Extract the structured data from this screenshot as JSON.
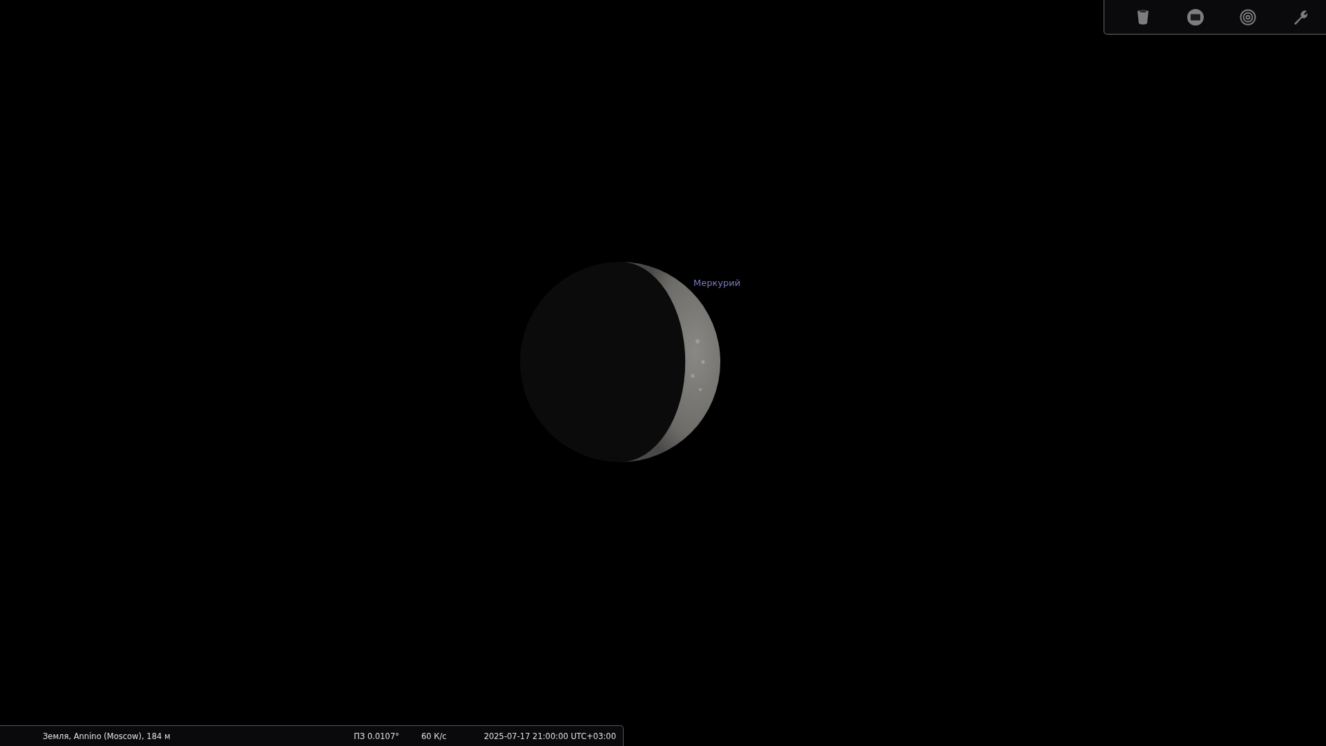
{
  "sky": {
    "object_label": "Меркурий"
  },
  "status_bar": {
    "location": "Земля, Annino (Moscow), 184 м",
    "fov": "ПЗ 0.0107°",
    "fps": "60 К/с",
    "datetime": "2025-07-17 21:00:00 UTC+03:00"
  }
}
